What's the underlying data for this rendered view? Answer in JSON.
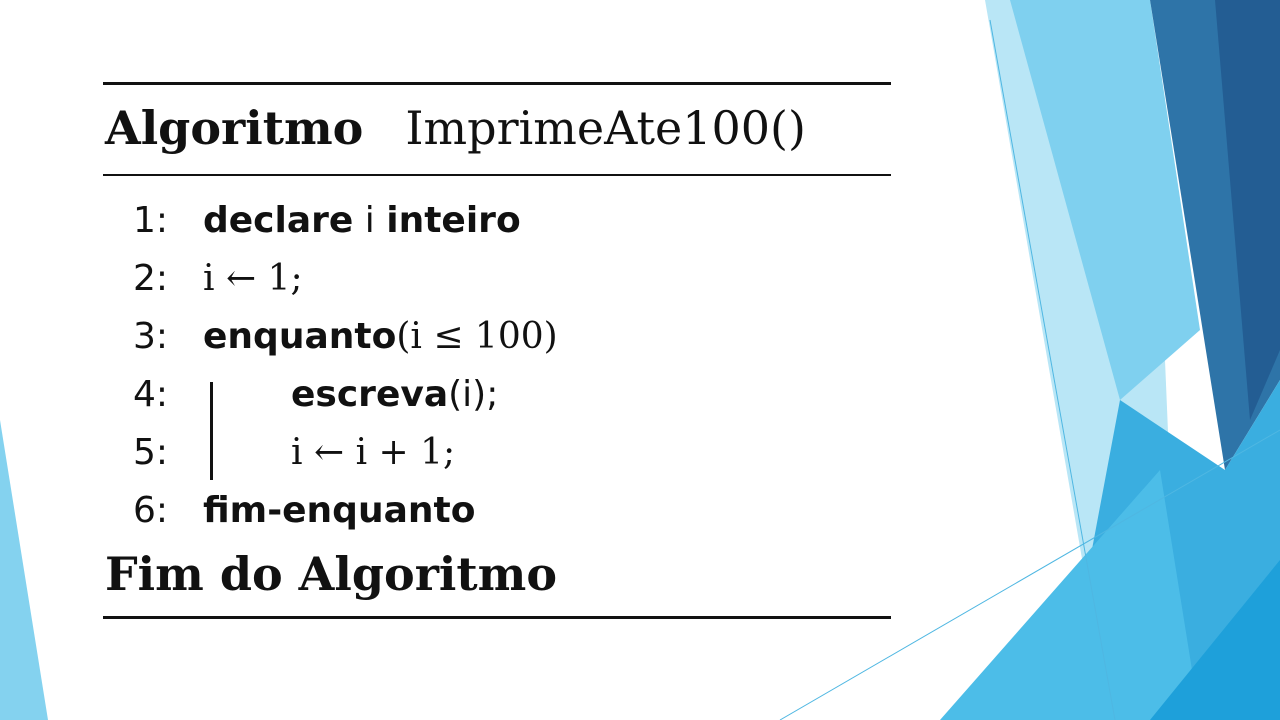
{
  "colors": {
    "light_blue": "#7fd0ef",
    "pale_blue": "#b9e6f6",
    "mid_blue": "#3aaee0",
    "steel_blue": "#2e74a8",
    "dark_blue": "#235d93",
    "bright_blue": "#1ea0da"
  },
  "algorithm": {
    "header_keyword": "Algoritmo",
    "name": "ImprimeAte100()",
    "lines": [
      {
        "num": "1:",
        "parts": [
          "declare",
          "i",
          "inteiro"
        ]
      },
      {
        "num": "2:",
        "expr": "i ← 1;"
      },
      {
        "num": "3:",
        "keyword": "enquanto",
        "expr": "(i ≤ 100)"
      },
      {
        "num": "4:",
        "keyword": "escreva",
        "expr": "(i);"
      },
      {
        "num": "5:",
        "expr": "i ← i + 1;"
      },
      {
        "num": "6:",
        "keyword": "fim-enquanto"
      }
    ],
    "footer": "Fim do Algoritmo"
  }
}
